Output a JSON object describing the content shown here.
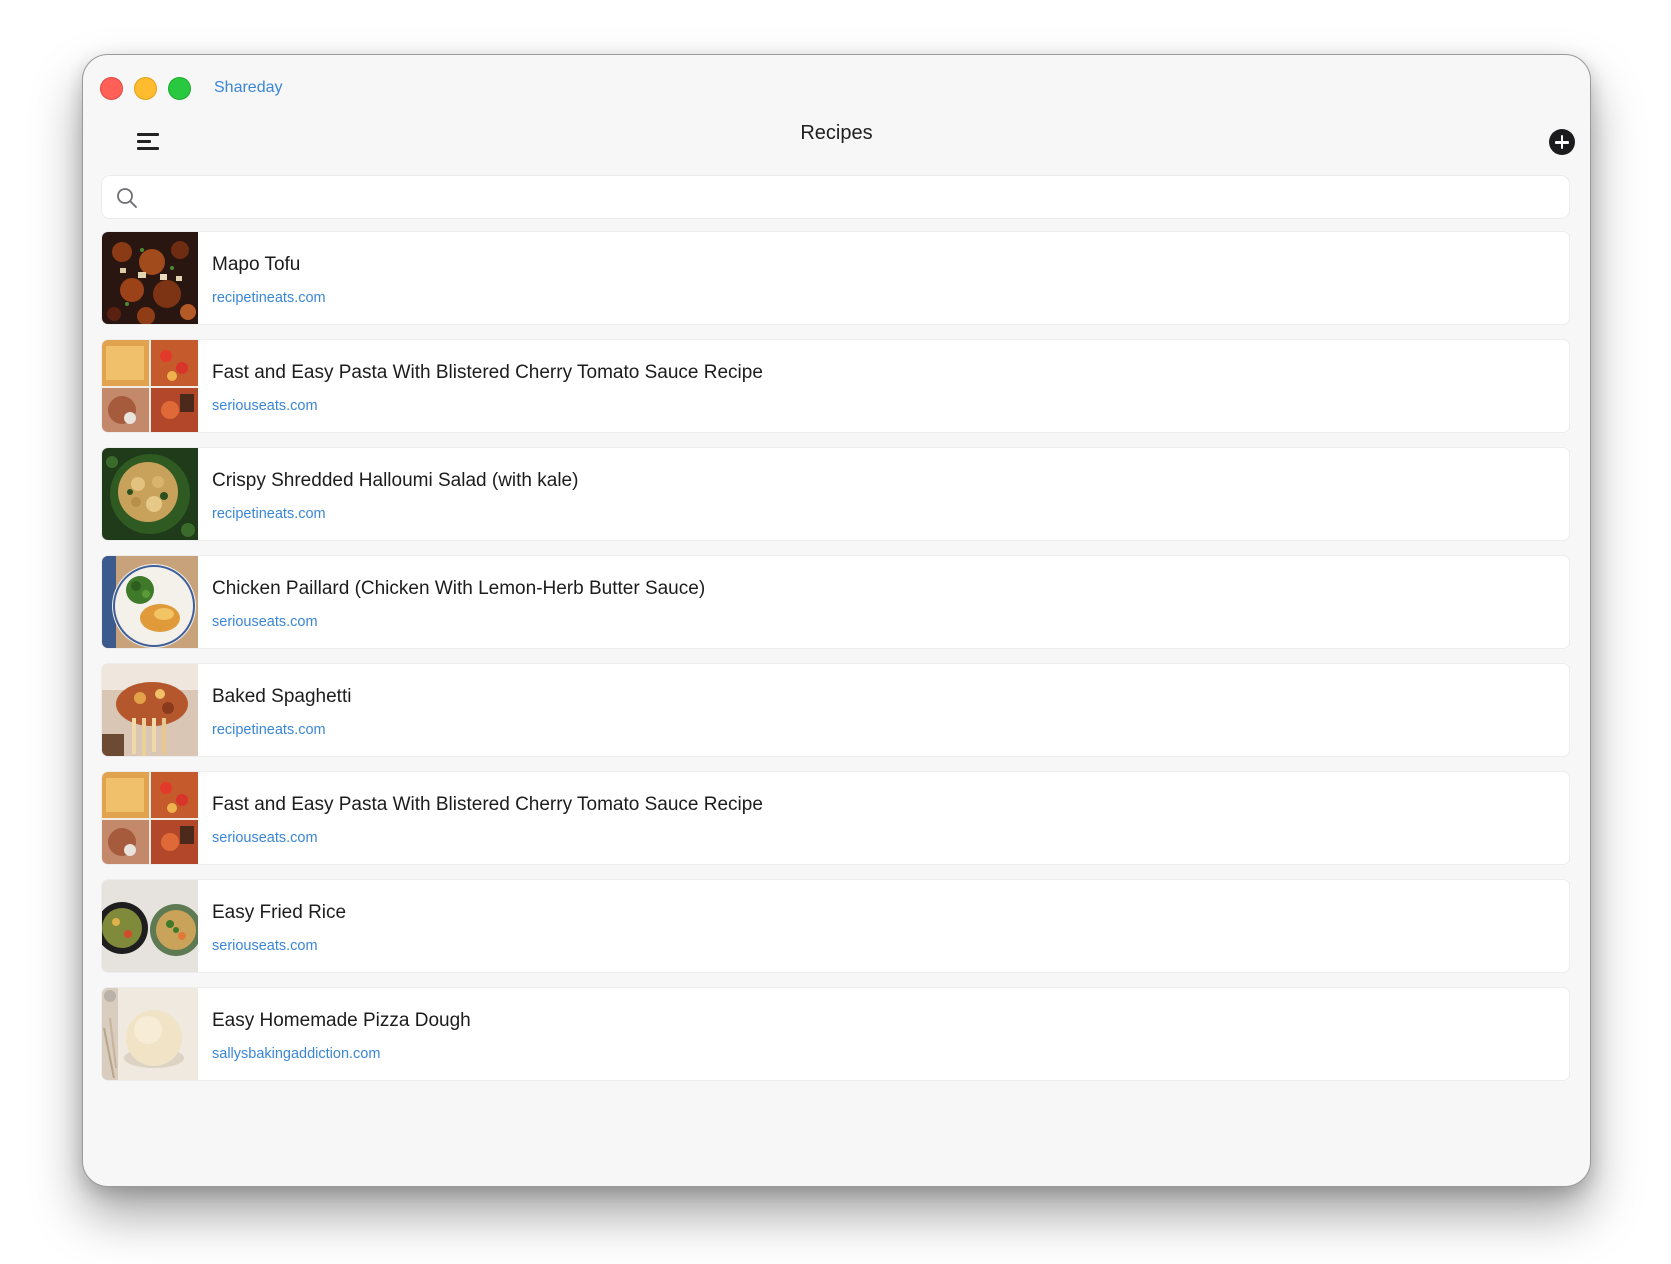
{
  "window": {
    "app_name": "Shareday"
  },
  "toolbar": {
    "title": "Recipes",
    "menu_icon": "hamburger-menu-icon",
    "add_icon": "plus-circle-icon"
  },
  "search": {
    "placeholder": "",
    "value": "",
    "icon": "search-icon"
  },
  "colors": {
    "accent": "#3a86d6",
    "close": "#fe5f57",
    "minimize": "#febc2e",
    "maximize": "#28c840"
  },
  "recipes": [
    {
      "title": "Mapo Tofu",
      "source": "recipetineats.com",
      "thumbnail": "mapo-tofu"
    },
    {
      "title": "Fast and Easy Pasta With Blistered Cherry Tomato Sauce Recipe",
      "source": "seriouseats.com",
      "thumbnail": "pasta-grid"
    },
    {
      "title": "Crispy Shredded Halloumi Salad (with kale)",
      "source": "recipetineats.com",
      "thumbnail": "halloumi-salad"
    },
    {
      "title": "Chicken Paillard (Chicken With Lemon-Herb Butter Sauce)",
      "source": "seriouseats.com",
      "thumbnail": "chicken-paillard"
    },
    {
      "title": "Baked Spaghetti",
      "source": "recipetineats.com",
      "thumbnail": "baked-spaghetti"
    },
    {
      "title": "Fast and Easy Pasta With Blistered Cherry Tomato Sauce Recipe",
      "source": "seriouseats.com",
      "thumbnail": "pasta-grid"
    },
    {
      "title": "Easy Fried Rice",
      "source": "seriouseats.com",
      "thumbnail": "fried-rice"
    },
    {
      "title": "Easy Homemade Pizza Dough",
      "source": "sallysbakingaddiction.com",
      "thumbnail": "pizza-dough"
    }
  ]
}
